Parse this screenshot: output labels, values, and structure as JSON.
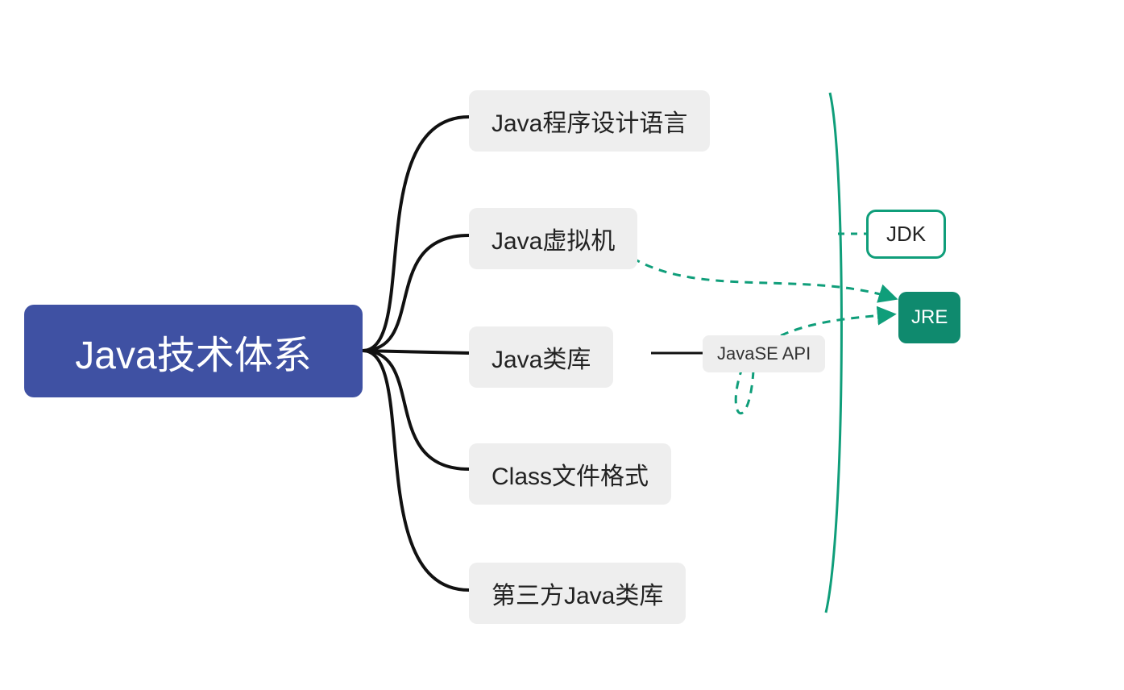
{
  "diagram": {
    "root": {
      "label": "Java技术体系"
    },
    "children": [
      {
        "label": "Java程序设计语言"
      },
      {
        "label": "Java虚拟机"
      },
      {
        "label": "Java类库"
      },
      {
        "label": "Class文件格式"
      },
      {
        "label": "第三方Java类库"
      }
    ],
    "subchild": {
      "label": "JavaSE API"
    },
    "annotations": {
      "jdk": "JDK",
      "jre": "JRE"
    }
  }
}
